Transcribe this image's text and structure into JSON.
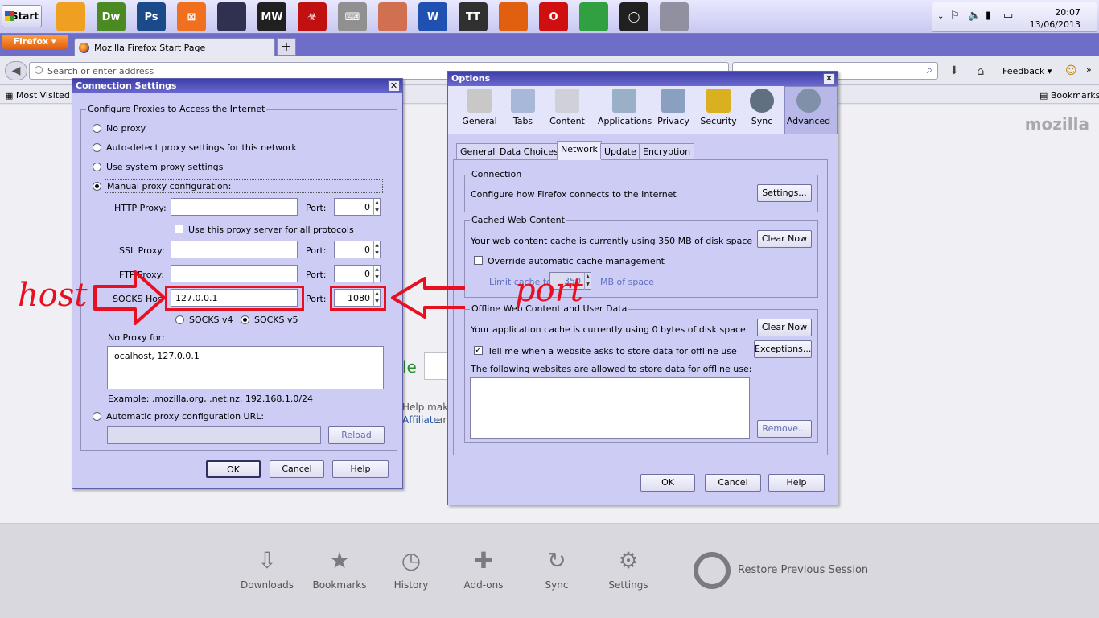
{
  "taskbar": {
    "start_label": "Start",
    "apps": [
      {
        "name": "aimp-icon",
        "text": "",
        "color": "#f0a020"
      },
      {
        "name": "dreamweaver-icon",
        "text": "Dw",
        "color": "#4a8a20"
      },
      {
        "name": "photoshop-icon",
        "text": "Ps",
        "color": "#1a4a8a"
      },
      {
        "name": "xampp-icon",
        "text": "⊠",
        "color": "#f07020"
      },
      {
        "name": "game-icon",
        "text": "",
        "color": "#303050"
      },
      {
        "name": "nfs-icon",
        "text": "MW",
        "color": "#202020"
      },
      {
        "name": "biohazard-icon",
        "text": "☣",
        "color": "#c01010"
      },
      {
        "name": "keyboard-icon",
        "text": "⌨",
        "color": "#909090"
      },
      {
        "name": "worms-icon",
        "text": "",
        "color": "#d07050"
      },
      {
        "name": "word-icon",
        "text": "W",
        "color": "#2050b0"
      },
      {
        "name": "tt-icon",
        "text": "TT",
        "color": "#303030"
      },
      {
        "name": "firefox-icon",
        "text": "",
        "color": "#e06010"
      },
      {
        "name": "opera-icon",
        "text": "O",
        "color": "#d01010"
      },
      {
        "name": "chrome-icon",
        "text": "",
        "color": "#30a040"
      },
      {
        "name": "camtasia-icon",
        "text": "◯",
        "color": "#202020"
      },
      {
        "name": "satellite-icon",
        "text": "",
        "color": "#9090a0"
      }
    ],
    "clock_time": "20:07",
    "clock_date": "13/06/2013"
  },
  "browser": {
    "menu_button": "Firefox",
    "tab_title": "Mozilla Firefox Start Page",
    "new_tab": "+",
    "url_placeholder": "Search or enter address",
    "feedback": "Feedback",
    "most_visited": "Most Visited",
    "bookmarks": "Bookmarks",
    "brand": "mozilla",
    "behind_text_1": "Help make",
    "behind_text_2": "Affiliate",
    "behind_text_3": "an",
    "behind_text_4": "le"
  },
  "launcher": {
    "items": [
      {
        "label": "Downloads",
        "icon": "⇩"
      },
      {
        "label": "Bookmarks",
        "icon": "★"
      },
      {
        "label": "History",
        "icon": "◷"
      },
      {
        "label": "Add-ons",
        "icon": "✚"
      },
      {
        "label": "Sync",
        "icon": "↻"
      },
      {
        "label": "Settings",
        "icon": "⚙"
      }
    ],
    "restore": "Restore Previous Session"
  },
  "connection": {
    "title": "Connection Settings",
    "close": "✕",
    "group_label": "Configure Proxies to Access the Internet",
    "no_proxy": "No proxy",
    "auto_detect": "Auto-detect proxy settings for this network",
    "system_proxy": "Use system proxy settings",
    "manual": "Manual proxy configuration:",
    "http_label": "HTTP Proxy:",
    "port_label": "Port:",
    "http_port": "0",
    "use_all": "Use this proxy server for all protocols",
    "ssl_label": "SSL Proxy:",
    "ssl_port": "0",
    "ftp_label": "FTP Proxy:",
    "ftp_port": "0",
    "socks_label": "SOCKS Hos",
    "socks_host": "127.0.0.1",
    "socks_port": "1080",
    "socks_v4": "SOCKS v4",
    "socks_v5": "SOCKS v5",
    "no_proxy_for": "No Proxy for:",
    "no_proxy_value": "localhost, 127.0.0.1",
    "example": "Example: .mozilla.org, .net.nz, 192.168.1.0/24",
    "auto_url": "Automatic proxy configuration URL:",
    "reload": "Reload",
    "ok": "OK",
    "cancel": "Cancel",
    "help": "Help"
  },
  "options": {
    "title": "Options",
    "close": "✕",
    "categories": [
      "General",
      "Tabs",
      "Content",
      "Applications",
      "Privacy",
      "Security",
      "Sync",
      "Advanced"
    ],
    "tabs": [
      "General",
      "Data Choices",
      "Network",
      "Update",
      "Encryption"
    ],
    "connection_label": "Connection",
    "connection_text": "Configure how Firefox connects to the Internet",
    "settings_btn": "Settings...",
    "cache_label": "Cached Web Content",
    "cache_text": "Your web content cache is currently using 350 MB of disk space",
    "clear_now": "Clear Now",
    "override": "Override automatic cache management",
    "limit_to": "Limit cache to",
    "limit_value": "350",
    "mb_space": "MB of space",
    "offline_label": "Offline Web Content and User Data",
    "offline_text": "Your application cache is currently using 0 bytes of disk space",
    "clear_now_2": "Clear Now",
    "tell_me": "Tell me when a website asks to store data for offline use",
    "exceptions": "Exceptions...",
    "following": "The following websites are allowed to store data for offline use:",
    "remove": "Remove...",
    "ok": "OK",
    "cancel": "Cancel",
    "help": "Help"
  },
  "annotations": {
    "host": "host",
    "port": "port"
  }
}
